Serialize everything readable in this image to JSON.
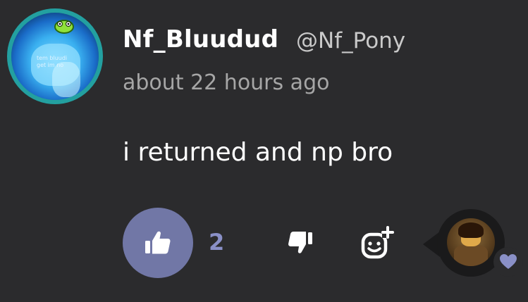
{
  "post": {
    "author_name": "Nf_Bluudud",
    "author_handle": "@Nf_Pony",
    "timestamp": "about 22 hours ago",
    "message": "i returned and np bro",
    "avatar_text_line1": "tem bluudi",
    "avatar_text_line2": "get im no"
  },
  "actions": {
    "like_icon": "thumbs-up-icon",
    "like_count": "2",
    "dislike_icon": "thumbs-down-icon",
    "add_reaction_icon": "add-reaction-icon",
    "reaction_icon": "heart-icon"
  },
  "colors": {
    "background": "#2b2b2d",
    "like_button": "#7177a6",
    "like_count": "#8a90c7",
    "heart": "#8a90c7"
  }
}
